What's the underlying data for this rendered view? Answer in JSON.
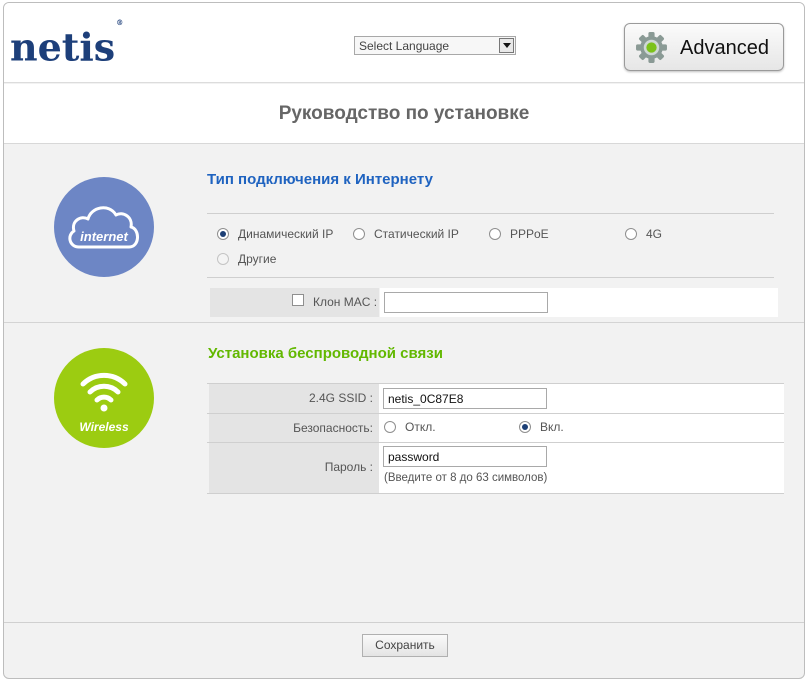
{
  "header": {
    "logo_text": "netis",
    "logo_mark": "®",
    "language_select": {
      "value": "Select Language",
      "arrow_icon": "chevron-down-icon"
    },
    "advanced_button": {
      "label": "Advanced",
      "icon": "gear-icon"
    }
  },
  "page_title": "Руководство по установке",
  "internet": {
    "icon_label": "internet",
    "icon_color": "#6d86c5",
    "title": "Тип подключения к Интернету",
    "title_color": "#1f63c0",
    "options": [
      {
        "label": "Динамический IP",
        "selected": true,
        "enabled": true
      },
      {
        "label": "Статический IP",
        "selected": false,
        "enabled": true
      },
      {
        "label": "PPPoE",
        "selected": false,
        "enabled": true
      },
      {
        "label": "4G",
        "selected": false,
        "enabled": true
      },
      {
        "label": "Другие",
        "selected": false,
        "enabled": false
      }
    ],
    "mac_clone": {
      "label": "Клон MAC :",
      "checked": false,
      "value": ""
    }
  },
  "wireless": {
    "icon_label": "Wireless",
    "icon_color": "#9ccc11",
    "title": "Установка беспроводной связи",
    "title_color": "#62b800",
    "ssid": {
      "label": "2.4G SSID :",
      "value": "netis_0C87E8"
    },
    "security": {
      "label": "Безопасность:",
      "options": [
        {
          "label": "Откл.",
          "selected": false
        },
        {
          "label": "Вкл.",
          "selected": true
        }
      ]
    },
    "password": {
      "label": "Пароль :",
      "value": "password",
      "hint": "(Введите от 8 до 63 символов)"
    }
  },
  "footer": {
    "save_label": "Сохранить"
  }
}
